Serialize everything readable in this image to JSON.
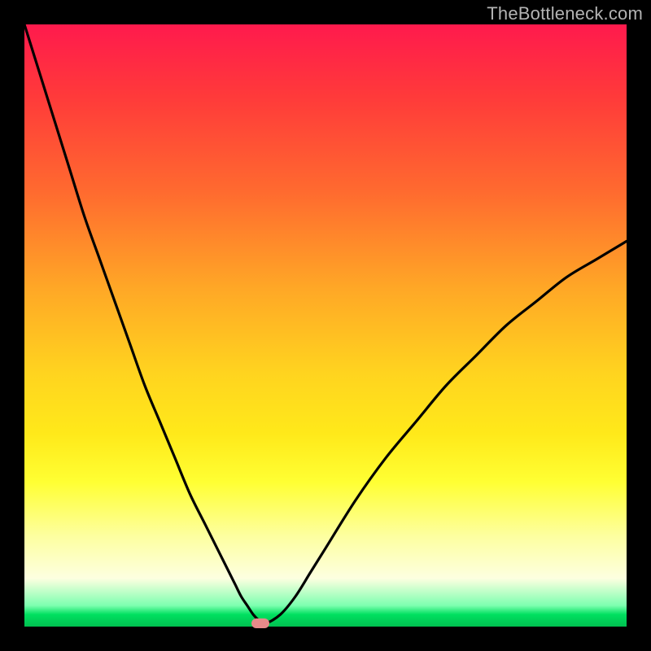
{
  "watermark": "TheBottleneck.com",
  "chart_data": {
    "type": "line",
    "title": "",
    "xlabel": "",
    "ylabel": "",
    "xlim": [
      0,
      100
    ],
    "ylim": [
      0,
      100
    ],
    "grid": false,
    "legend": false,
    "background_gradient": {
      "direction": "top-to-bottom",
      "stops": [
        {
          "pos": 0.0,
          "color": "#ff1a4d"
        },
        {
          "pos": 0.12,
          "color": "#ff3a3a"
        },
        {
          "pos": 0.28,
          "color": "#ff6b2f"
        },
        {
          "pos": 0.44,
          "color": "#ffa826"
        },
        {
          "pos": 0.58,
          "color": "#ffd41f"
        },
        {
          "pos": 0.68,
          "color": "#ffe91a"
        },
        {
          "pos": 0.76,
          "color": "#ffff33"
        },
        {
          "pos": 0.85,
          "color": "#fdffa0"
        },
        {
          "pos": 0.92,
          "color": "#fdffe0"
        },
        {
          "pos": 0.965,
          "color": "#7dffb0"
        },
        {
          "pos": 0.98,
          "color": "#00e060"
        },
        {
          "pos": 1.0,
          "color": "#00c050"
        }
      ]
    },
    "series": [
      {
        "name": "bottleneck-curve",
        "color": "#000000",
        "x": [
          0,
          2.5,
          5,
          7.5,
          10,
          12.5,
          15,
          17.5,
          20,
          22.5,
          25,
          27.5,
          30,
          32.5,
          34,
          35,
          36,
          37,
          38,
          39,
          40,
          42.5,
          45,
          47.5,
          50,
          55,
          60,
          65,
          70,
          75,
          80,
          85,
          90,
          95,
          100
        ],
        "y": [
          100,
          92,
          84,
          76,
          68,
          61,
          54,
          47,
          40,
          34,
          28,
          22,
          17,
          12,
          9,
          7,
          5,
          3.5,
          2,
          1,
          0.5,
          2,
          5,
          9,
          13,
          21,
          28,
          34,
          40,
          45,
          50,
          54,
          58,
          61,
          64
        ]
      }
    ],
    "markers": [
      {
        "name": "minimum-marker",
        "x": 39.2,
        "y": 0.5,
        "color": "#e88a8a"
      }
    ]
  }
}
